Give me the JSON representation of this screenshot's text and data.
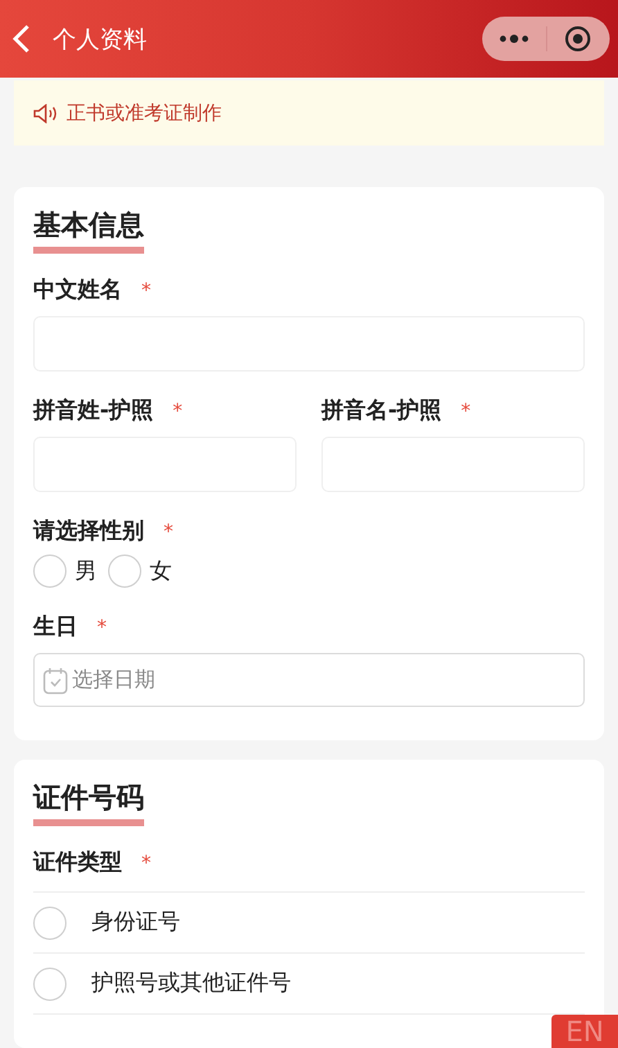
{
  "header": {
    "title": "个人资料"
  },
  "notice": {
    "text": "正书或准考证制作"
  },
  "sections": [
    {
      "title": "基本信息",
      "fields": [
        {
          "kind": "text",
          "label": "中文姓名",
          "required_mark": "*"
        },
        {
          "kind": "pair",
          "items": [
            {
              "label": "拼音姓-护照",
              "required_mark": "*"
            },
            {
              "label": "拼音名-护照",
              "required_mark": "*"
            }
          ]
        },
        {
          "kind": "radio_inline",
          "label": "请选择性别",
          "required_mark": "*",
          "options": [
            {
              "label": "男",
              "selected": false
            },
            {
              "label": "女",
              "selected": false
            }
          ]
        },
        {
          "kind": "date",
          "label": "生日",
          "required_mark": "*",
          "placeholder": "选择日期"
        }
      ]
    },
    {
      "title": "证件号码",
      "fields": [
        {
          "kind": "radio_list",
          "label": "证件类型",
          "required_mark": "*",
          "options": [
            {
              "label": "身份证号",
              "selected": false
            },
            {
              "label": "护照号或其他证件号",
              "selected": false
            }
          ]
        }
      ]
    }
  ],
  "lang_badge": "EN"
}
